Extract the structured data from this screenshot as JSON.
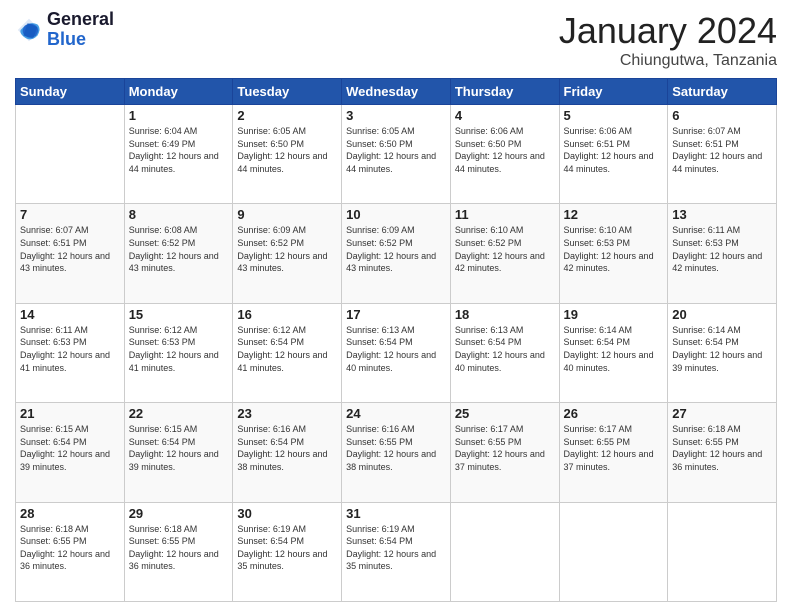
{
  "header": {
    "logo": {
      "general": "General",
      "blue": "Blue"
    },
    "title": "January 2024",
    "location": "Chiungutwa, Tanzania"
  },
  "days_of_week": [
    "Sunday",
    "Monday",
    "Tuesday",
    "Wednesday",
    "Thursday",
    "Friday",
    "Saturday"
  ],
  "weeks": [
    [
      {
        "day": "",
        "sunrise": "",
        "sunset": "",
        "daylight": ""
      },
      {
        "day": "1",
        "sunrise": "Sunrise: 6:04 AM",
        "sunset": "Sunset: 6:49 PM",
        "daylight": "Daylight: 12 hours and 44 minutes."
      },
      {
        "day": "2",
        "sunrise": "Sunrise: 6:05 AM",
        "sunset": "Sunset: 6:50 PM",
        "daylight": "Daylight: 12 hours and 44 minutes."
      },
      {
        "day": "3",
        "sunrise": "Sunrise: 6:05 AM",
        "sunset": "Sunset: 6:50 PM",
        "daylight": "Daylight: 12 hours and 44 minutes."
      },
      {
        "day": "4",
        "sunrise": "Sunrise: 6:06 AM",
        "sunset": "Sunset: 6:50 PM",
        "daylight": "Daylight: 12 hours and 44 minutes."
      },
      {
        "day": "5",
        "sunrise": "Sunrise: 6:06 AM",
        "sunset": "Sunset: 6:51 PM",
        "daylight": "Daylight: 12 hours and 44 minutes."
      },
      {
        "day": "6",
        "sunrise": "Sunrise: 6:07 AM",
        "sunset": "Sunset: 6:51 PM",
        "daylight": "Daylight: 12 hours and 44 minutes."
      }
    ],
    [
      {
        "day": "7",
        "sunrise": "Sunrise: 6:07 AM",
        "sunset": "Sunset: 6:51 PM",
        "daylight": "Daylight: 12 hours and 43 minutes."
      },
      {
        "day": "8",
        "sunrise": "Sunrise: 6:08 AM",
        "sunset": "Sunset: 6:52 PM",
        "daylight": "Daylight: 12 hours and 43 minutes."
      },
      {
        "day": "9",
        "sunrise": "Sunrise: 6:09 AM",
        "sunset": "Sunset: 6:52 PM",
        "daylight": "Daylight: 12 hours and 43 minutes."
      },
      {
        "day": "10",
        "sunrise": "Sunrise: 6:09 AM",
        "sunset": "Sunset: 6:52 PM",
        "daylight": "Daylight: 12 hours and 43 minutes."
      },
      {
        "day": "11",
        "sunrise": "Sunrise: 6:10 AM",
        "sunset": "Sunset: 6:52 PM",
        "daylight": "Daylight: 12 hours and 42 minutes."
      },
      {
        "day": "12",
        "sunrise": "Sunrise: 6:10 AM",
        "sunset": "Sunset: 6:53 PM",
        "daylight": "Daylight: 12 hours and 42 minutes."
      },
      {
        "day": "13",
        "sunrise": "Sunrise: 6:11 AM",
        "sunset": "Sunset: 6:53 PM",
        "daylight": "Daylight: 12 hours and 42 minutes."
      }
    ],
    [
      {
        "day": "14",
        "sunrise": "Sunrise: 6:11 AM",
        "sunset": "Sunset: 6:53 PM",
        "daylight": "Daylight: 12 hours and 41 minutes."
      },
      {
        "day": "15",
        "sunrise": "Sunrise: 6:12 AM",
        "sunset": "Sunset: 6:53 PM",
        "daylight": "Daylight: 12 hours and 41 minutes."
      },
      {
        "day": "16",
        "sunrise": "Sunrise: 6:12 AM",
        "sunset": "Sunset: 6:54 PM",
        "daylight": "Daylight: 12 hours and 41 minutes."
      },
      {
        "day": "17",
        "sunrise": "Sunrise: 6:13 AM",
        "sunset": "Sunset: 6:54 PM",
        "daylight": "Daylight: 12 hours and 40 minutes."
      },
      {
        "day": "18",
        "sunrise": "Sunrise: 6:13 AM",
        "sunset": "Sunset: 6:54 PM",
        "daylight": "Daylight: 12 hours and 40 minutes."
      },
      {
        "day": "19",
        "sunrise": "Sunrise: 6:14 AM",
        "sunset": "Sunset: 6:54 PM",
        "daylight": "Daylight: 12 hours and 40 minutes."
      },
      {
        "day": "20",
        "sunrise": "Sunrise: 6:14 AM",
        "sunset": "Sunset: 6:54 PM",
        "daylight": "Daylight: 12 hours and 39 minutes."
      }
    ],
    [
      {
        "day": "21",
        "sunrise": "Sunrise: 6:15 AM",
        "sunset": "Sunset: 6:54 PM",
        "daylight": "Daylight: 12 hours and 39 minutes."
      },
      {
        "day": "22",
        "sunrise": "Sunrise: 6:15 AM",
        "sunset": "Sunset: 6:54 PM",
        "daylight": "Daylight: 12 hours and 39 minutes."
      },
      {
        "day": "23",
        "sunrise": "Sunrise: 6:16 AM",
        "sunset": "Sunset: 6:54 PM",
        "daylight": "Daylight: 12 hours and 38 minutes."
      },
      {
        "day": "24",
        "sunrise": "Sunrise: 6:16 AM",
        "sunset": "Sunset: 6:55 PM",
        "daylight": "Daylight: 12 hours and 38 minutes."
      },
      {
        "day": "25",
        "sunrise": "Sunrise: 6:17 AM",
        "sunset": "Sunset: 6:55 PM",
        "daylight": "Daylight: 12 hours and 37 minutes."
      },
      {
        "day": "26",
        "sunrise": "Sunrise: 6:17 AM",
        "sunset": "Sunset: 6:55 PM",
        "daylight": "Daylight: 12 hours and 37 minutes."
      },
      {
        "day": "27",
        "sunrise": "Sunrise: 6:18 AM",
        "sunset": "Sunset: 6:55 PM",
        "daylight": "Daylight: 12 hours and 36 minutes."
      }
    ],
    [
      {
        "day": "28",
        "sunrise": "Sunrise: 6:18 AM",
        "sunset": "Sunset: 6:55 PM",
        "daylight": "Daylight: 12 hours and 36 minutes."
      },
      {
        "day": "29",
        "sunrise": "Sunrise: 6:18 AM",
        "sunset": "Sunset: 6:55 PM",
        "daylight": "Daylight: 12 hours and 36 minutes."
      },
      {
        "day": "30",
        "sunrise": "Sunrise: 6:19 AM",
        "sunset": "Sunset: 6:54 PM",
        "daylight": "Daylight: 12 hours and 35 minutes."
      },
      {
        "day": "31",
        "sunrise": "Sunrise: 6:19 AM",
        "sunset": "Sunset: 6:54 PM",
        "daylight": "Daylight: 12 hours and 35 minutes."
      },
      {
        "day": "",
        "sunrise": "",
        "sunset": "",
        "daylight": ""
      },
      {
        "day": "",
        "sunrise": "",
        "sunset": "",
        "daylight": ""
      },
      {
        "day": "",
        "sunrise": "",
        "sunset": "",
        "daylight": ""
      }
    ]
  ]
}
